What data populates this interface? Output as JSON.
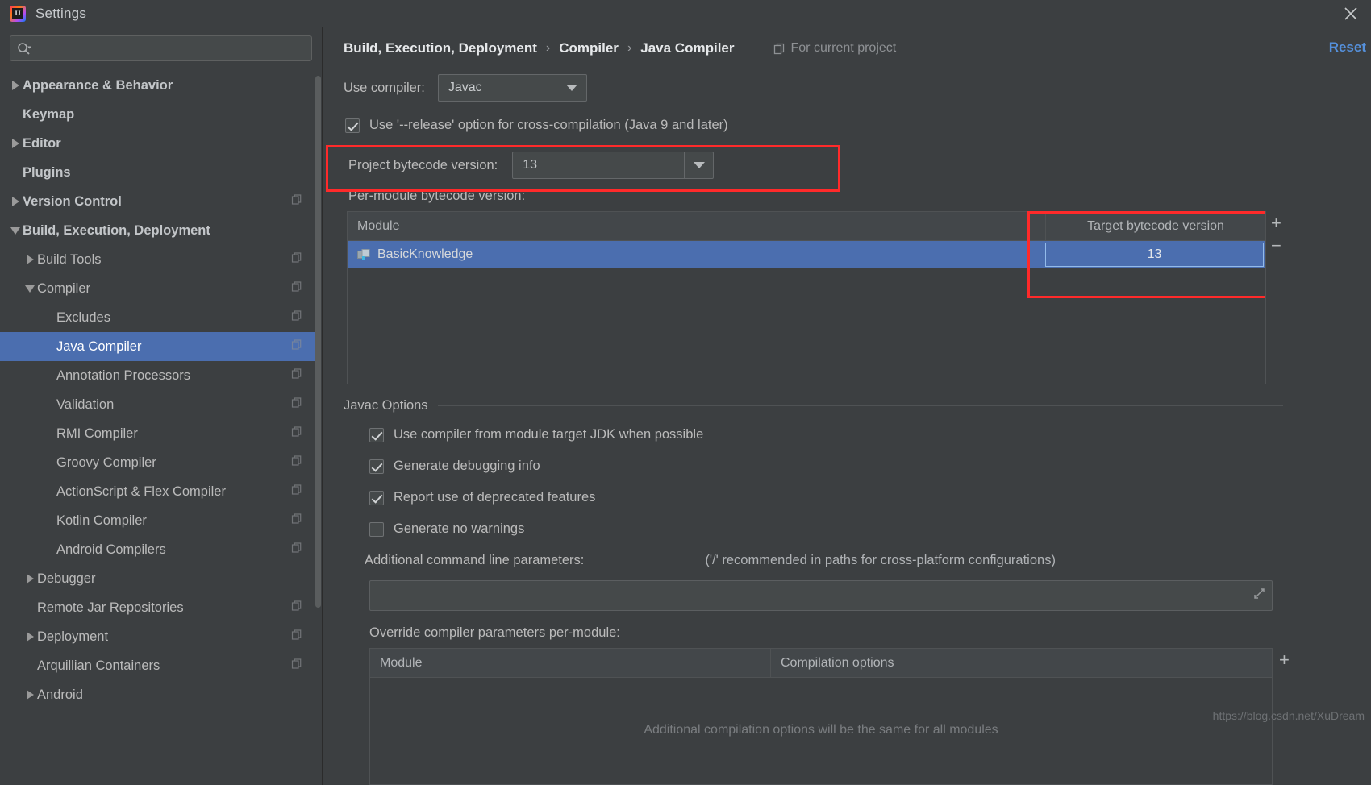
{
  "window": {
    "title": "Settings",
    "logo_text": "IJ",
    "close_label": "×"
  },
  "search": {
    "value": "",
    "placeholder": ""
  },
  "sidebar": {
    "items": [
      {
        "label": "Appearance & Behavior",
        "level": 0,
        "arrow": "right",
        "badge": false,
        "selected": false
      },
      {
        "label": "Keymap",
        "level": 0,
        "arrow": "none",
        "badge": false,
        "selected": false
      },
      {
        "label": "Editor",
        "level": 0,
        "arrow": "right",
        "badge": false,
        "selected": false
      },
      {
        "label": "Plugins",
        "level": 0,
        "arrow": "none",
        "badge": false,
        "selected": false
      },
      {
        "label": "Version Control",
        "level": 0,
        "arrow": "right",
        "badge": true,
        "selected": false
      },
      {
        "label": "Build, Execution, Deployment",
        "level": 0,
        "arrow": "down",
        "badge": false,
        "selected": false
      },
      {
        "label": "Build Tools",
        "level": 1,
        "arrow": "right",
        "badge": true,
        "selected": false
      },
      {
        "label": "Compiler",
        "level": 1,
        "arrow": "down",
        "badge": true,
        "selected": false
      },
      {
        "label": "Excludes",
        "level": 2,
        "arrow": "none",
        "badge": true,
        "selected": false
      },
      {
        "label": "Java Compiler",
        "level": 2,
        "arrow": "none",
        "badge": true,
        "selected": true
      },
      {
        "label": "Annotation Processors",
        "level": 2,
        "arrow": "none",
        "badge": true,
        "selected": false
      },
      {
        "label": "Validation",
        "level": 2,
        "arrow": "none",
        "badge": true,
        "selected": false
      },
      {
        "label": "RMI Compiler",
        "level": 2,
        "arrow": "none",
        "badge": true,
        "selected": false
      },
      {
        "label": "Groovy Compiler",
        "level": 2,
        "arrow": "none",
        "badge": true,
        "selected": false
      },
      {
        "label": "ActionScript & Flex Compiler",
        "level": 2,
        "arrow": "none",
        "badge": true,
        "selected": false
      },
      {
        "label": "Kotlin Compiler",
        "level": 2,
        "arrow": "none",
        "badge": true,
        "selected": false
      },
      {
        "label": "Android Compilers",
        "level": 2,
        "arrow": "none",
        "badge": true,
        "selected": false
      },
      {
        "label": "Debugger",
        "level": 1,
        "arrow": "right",
        "badge": false,
        "selected": false
      },
      {
        "label": "Remote Jar Repositories",
        "level": 1,
        "arrow": "none",
        "badge": true,
        "selected": false
      },
      {
        "label": "Deployment",
        "level": 1,
        "arrow": "right",
        "badge": true,
        "selected": false
      },
      {
        "label": "Arquillian Containers",
        "level": 1,
        "arrow": "none",
        "badge": true,
        "selected": false
      },
      {
        "label": "Android",
        "level": 1,
        "arrow": "right",
        "badge": false,
        "selected": false
      }
    ]
  },
  "header": {
    "breadcrumb": [
      "Build, Execution, Deployment",
      "Compiler",
      "Java Compiler"
    ],
    "separator": "›",
    "for_current_project": "For current project",
    "reset_label": "Reset"
  },
  "main": {
    "use_compiler_label": "Use compiler:",
    "use_compiler_value": "Javac",
    "release_option_label": "Use '--release' option for cross-compilation (Java 9 and later)",
    "release_option_checked": true,
    "project_bytecode_label": "Project bytecode version:",
    "project_bytecode_value": "13",
    "per_module_label": "Per-module bytecode version:",
    "module_table": {
      "columns": [
        "Module",
        "Target bytecode version"
      ],
      "rows": [
        {
          "module": "BasicKnowledge",
          "target": "13",
          "selected": true
        }
      ],
      "add_label": "+",
      "remove_label": "−"
    },
    "javac_options_title": "Javac Options",
    "javac_options": [
      {
        "label": "Use compiler from module target JDK when possible",
        "checked": true
      },
      {
        "label": "Generate debugging info",
        "checked": true
      },
      {
        "label": "Report use of deprecated features",
        "checked": true
      },
      {
        "label": "Generate no warnings",
        "checked": false
      }
    ],
    "additional_params_label": "Additional command line parameters:",
    "additional_params_hint": "('/' recommended in paths for cross-platform configurations)",
    "additional_params_value": "",
    "override_label": "Override compiler parameters per-module:",
    "override_table": {
      "columns": [
        "Module",
        "Compilation options"
      ],
      "empty_hint": "Additional compilation options will be the same for all modules",
      "add_label": "+"
    }
  },
  "watermark": "https://blog.csdn.net/XuDream",
  "colors": {
    "background": "#3C3F41",
    "selection": "#4B6EAF",
    "accent_link": "#5590DB",
    "annotation": "#FF2A2A"
  }
}
